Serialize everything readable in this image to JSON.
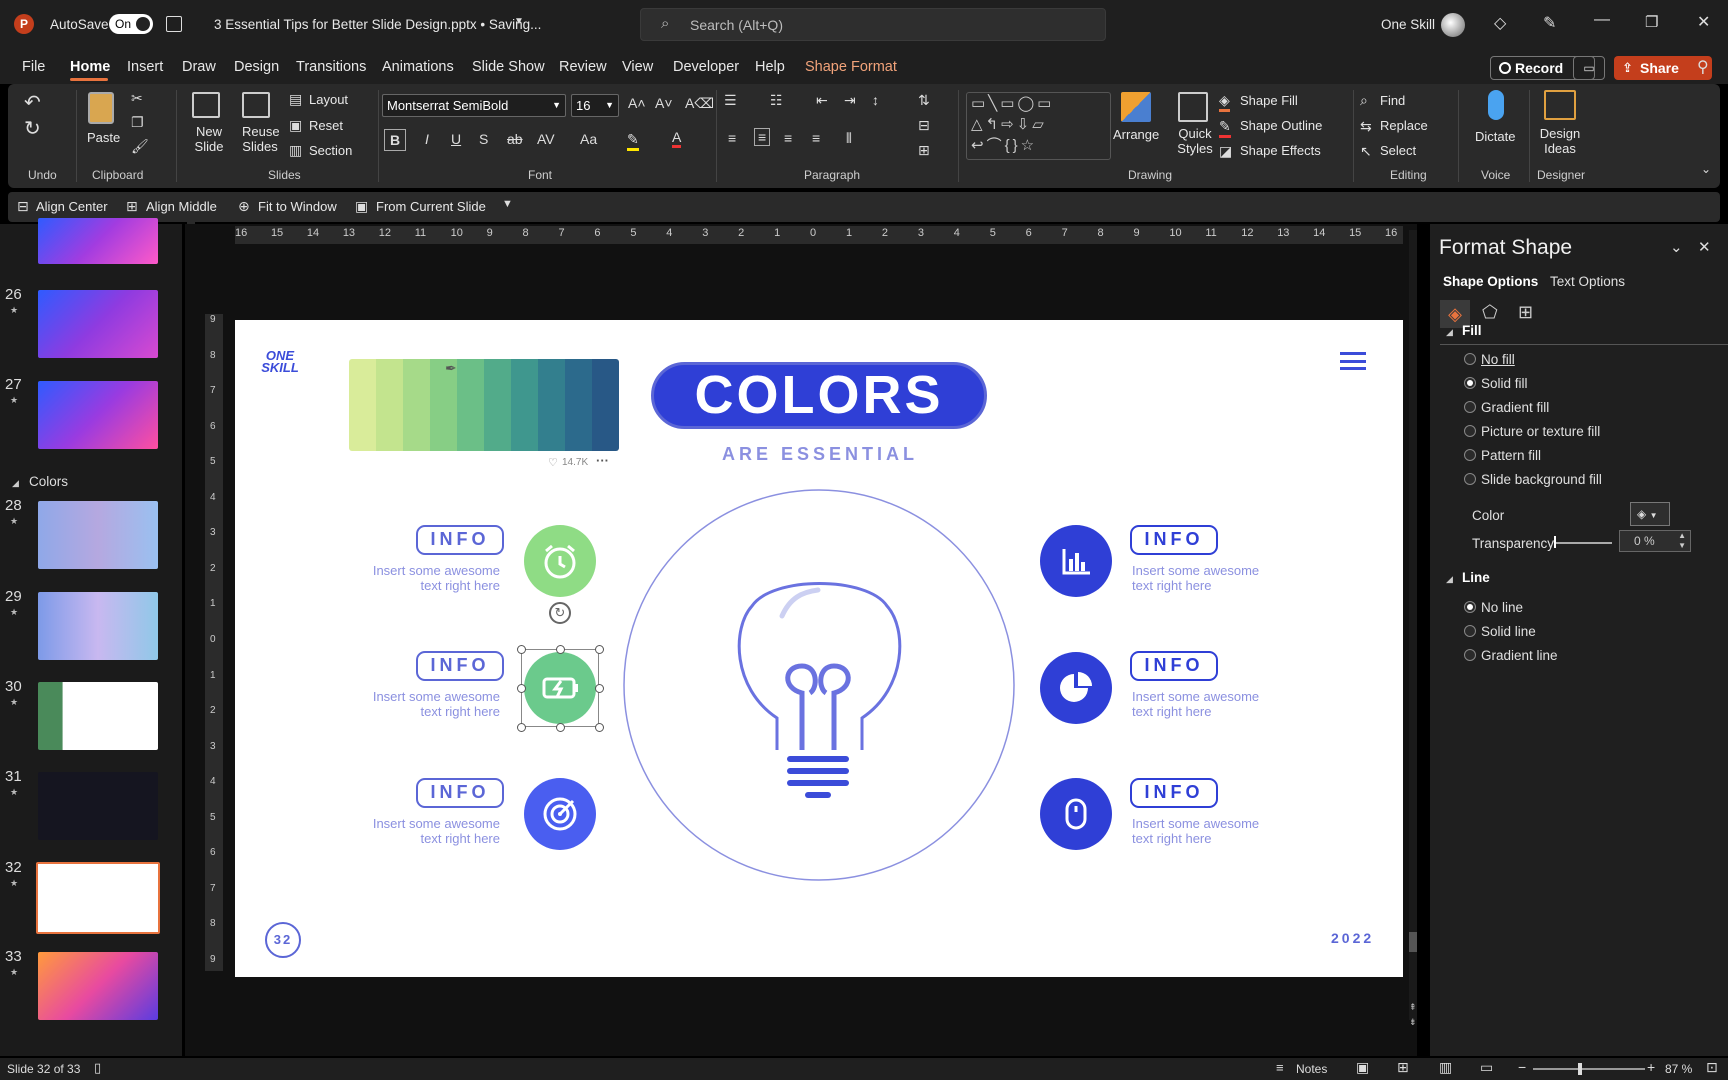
{
  "app": {
    "autosave_label": "AutoSave",
    "autosave_state": "On",
    "doc_title": "3 Essential Tips for Better Slide Design.pptx • Saving...",
    "search_placeholder": "Search (Alt+Q)",
    "user": "One Skill"
  },
  "tabs": [
    "File",
    "Home",
    "Insert",
    "Draw",
    "Design",
    "Transitions",
    "Animations",
    "Slide Show",
    "Review",
    "View",
    "Developer",
    "Help",
    "Shape Format"
  ],
  "actions": {
    "record": "Record",
    "share": "Share"
  },
  "ribbon": {
    "undo": "Undo",
    "clipboard": "Clipboard",
    "paste": "Paste",
    "slides": "Slides",
    "new_slide": "New Slide",
    "reuse_slides": "Reuse Slides",
    "layout": "Layout",
    "reset": "Reset",
    "section": "Section",
    "font": "Font",
    "font_name": "Montserrat SemiBold",
    "font_size": "16",
    "paragraph": "Paragraph",
    "drawing": "Drawing",
    "arrange": "Arrange",
    "quick_styles": "Quick Styles",
    "shape_fill": "Shape Fill",
    "shape_outline": "Shape Outline",
    "shape_effects": "Shape Effects",
    "find": "Find",
    "replace": "Replace",
    "select": "Select",
    "editing": "Editing",
    "dictate": "Dictate",
    "voice": "Voice",
    "design_ideas": "Design Ideas",
    "designer": "Designer"
  },
  "qat": [
    "Align Center",
    "Align Middle",
    "Fit to Window",
    "From Current Slide"
  ],
  "thumbs": [
    {
      "num": "26"
    },
    {
      "num": "27"
    },
    {
      "section": "Colors"
    },
    {
      "num": "28"
    },
    {
      "num": "29"
    },
    {
      "num": "30"
    },
    {
      "num": "31"
    },
    {
      "num": "32"
    },
    {
      "num": "33"
    }
  ],
  "ruler_h": [
    "16",
    "15",
    "14",
    "13",
    "12",
    "11",
    "10",
    "9",
    "8",
    "7",
    "6",
    "5",
    "4",
    "3",
    "2",
    "1",
    "0",
    "1",
    "2",
    "3",
    "4",
    "5",
    "6",
    "7",
    "8",
    "9",
    "10",
    "11",
    "12",
    "13",
    "14",
    "15",
    "16"
  ],
  "ruler_v": [
    "9",
    "8",
    "7",
    "6",
    "5",
    "4",
    "3",
    "2",
    "1",
    "0",
    "1",
    "2",
    "3",
    "4",
    "5",
    "6",
    "7",
    "8",
    "9"
  ],
  "slide": {
    "logo_line1": "ONE",
    "logo_line2": "SKILL",
    "title": "COLORS",
    "subtitle": "ARE ESSENTIAL",
    "likes": "14.7K",
    "more": "···",
    "info": "INFO",
    "body": "Insert some awesome text right here",
    "page": "32",
    "year": "2022",
    "palette": [
      "#d9ec9a",
      "#c3e48e",
      "#a6da89",
      "#87ce85",
      "#6bbf87",
      "#52ab8a",
      "#3f978e",
      "#337f8e",
      "#2c6a8c",
      "#285886"
    ]
  },
  "pane": {
    "title": "Format Shape",
    "tab1": "Shape Options",
    "tab2": "Text Options",
    "fill": "Fill",
    "fill_opts": [
      "No fill",
      "Solid fill",
      "Gradient fill",
      "Picture or texture fill",
      "Pattern fill",
      "Slide background fill"
    ],
    "color": "Color",
    "transparency": "Transparency",
    "transparency_val": "0 %",
    "line": "Line",
    "line_opts": [
      "No line",
      "Solid line",
      "Gradient line"
    ]
  },
  "status": {
    "slide_info": "Slide 32 of 33",
    "notes": "Notes",
    "zoom": "87 %"
  }
}
